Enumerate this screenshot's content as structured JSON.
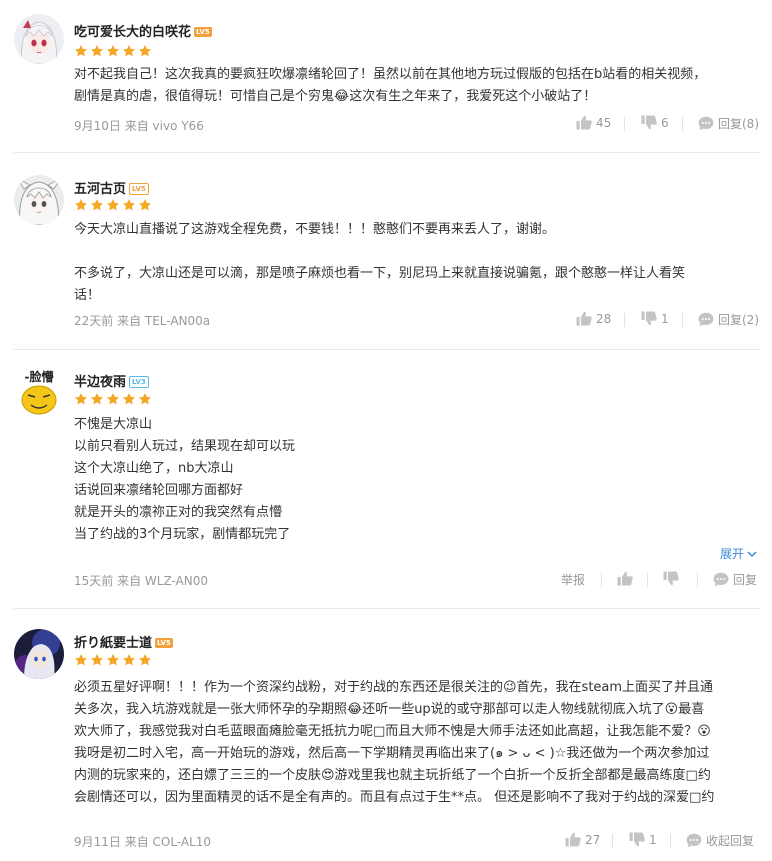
{
  "reviews": [
    {
      "username": "吃可爱长大的白咲花",
      "level": "LV5",
      "rating": 5,
      "lines": [
        "对不起我自己！这次我真的要疯狂吹爆凛绪轮回了！虽然以前在其他地方玩过假版的包括在b站看的相关视频，",
        "剧情是真的虐，很值得玩！可惜自己是个穷鬼😂这次有生之年来了，我爱死这个小破站了！"
      ],
      "meta": "9月10日 来自 vivo Y66",
      "likes": "45",
      "dislikes": "6",
      "reply_label": "回复(8)"
    },
    {
      "username": "五河古页",
      "level": "LV5",
      "rating": 5,
      "lines": [
        "今天大凉山直播说了这游戏全程免费，不要钱！！！憨憨们不要再来丢人了，谢谢。",
        "",
        "不多说了，大凉山还是可以滴，那是喷子麻烦也看一下，别尼玛上来就直接说骗氪，跟个憨憨一样让人看笑",
        "话！"
      ],
      "meta": "22天前 来自 TEL-AN00a",
      "likes": "28",
      "dislikes": "1",
      "reply_label": "回复(2)"
    },
    {
      "username": "半边夜雨",
      "level": "LV3",
      "rating": 5,
      "avatar_text": "-脸懵",
      "lines": [
        "不愧是大凉山",
        "以前只看别人玩过，结果现在却可以玩",
        "这个大凉山绝了，nb大凉山",
        "话说回来凛绪轮回哪方面都好",
        "就是开头的凛祢正对的我突然有点懵",
        "当了约战的3个月玩家，剧情都玩完了"
      ],
      "expand_label": "展开",
      "meta": "15天前 来自 WLZ-AN00",
      "report_label": "举报",
      "reply_label": "回复"
    },
    {
      "username": "折り紙要士道",
      "level": "LV5",
      "rating": 5,
      "lines": [
        "必须五星好评啊！！！作为一个资深约战粉，对于约战的东西还是很关注的😉首先，我在steam上面买了并且通",
        "关多次，我入坑游戏就是一张大师怀孕的孕期照😂还听一些up说的或守那部可以走人物线就彻底入坑了😮最喜",
        "欢大师了，我感觉我对白毛蓝眼面瘫脸毫无抵抗力呢□而且大师不愧是大师手法还如此高超，让我怎能不爱？😮",
        "我呀是初二时入宅，高一开始玩的游戏，然后高一下学期精灵再临出来了(๑ > ᴗ < )☆我还做为一个两次参加过",
        "内测的玩家来的，还白嫖了三三的一个皮肤😍游戏里我也就主玩折纸了一个白折一个反折全部都是最高练度□约",
        "会剧情还可以，因为里面精灵的话不是全有声的。而且有点过于生**点。 但还是影响不了我对于约战的深爱□约"
      ],
      "meta": "9月11日 来自 COL-AL10",
      "likes": "27",
      "dislikes": "1",
      "reply_label": "收起回复"
    }
  ],
  "colors": {
    "star": "#f5a623",
    "link": "#3a8bd6",
    "meta": "#999999",
    "divider": "#e8e8e8"
  },
  "icons": {
    "like": "thumbs-up-icon",
    "dislike": "thumbs-down-icon",
    "reply": "comment-bubble-icon",
    "expand": "chevron-down-icon",
    "star": "star-icon"
  }
}
